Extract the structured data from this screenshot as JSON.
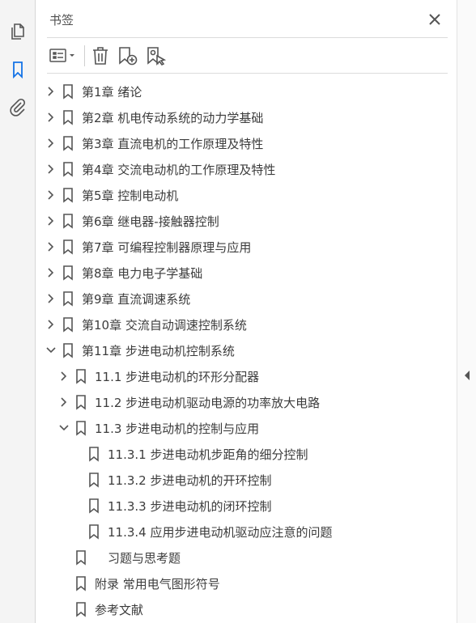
{
  "panel": {
    "title": "书签"
  },
  "rail": [
    {
      "icon": "pages-icon",
      "active": false
    },
    {
      "icon": "bookmark-icon",
      "active": true
    },
    {
      "icon": "paperclip-icon",
      "active": false
    }
  ],
  "toolbar": [
    "options-menu-icon",
    "delete-icon",
    "new-bookmark-icon",
    "bookmark-from-selection-icon"
  ],
  "colors": {
    "accent": "#1473e6",
    "icon": "#555555",
    "text": "#3c3c3c"
  },
  "bookmarks": [
    {
      "label": "第1章 绪论",
      "level": 0,
      "state": "collapsed"
    },
    {
      "label": "第2章 机电传动系统的动力学基础",
      "level": 0,
      "state": "collapsed"
    },
    {
      "label": "第3章 直流电机的工作原理及特性",
      "level": 0,
      "state": "collapsed"
    },
    {
      "label": "第4章 交流电动机的工作原理及特性",
      "level": 0,
      "state": "collapsed"
    },
    {
      "label": "第5章 控制电动机",
      "level": 0,
      "state": "collapsed"
    },
    {
      "label": "第6章 继电器-接触器控制",
      "level": 0,
      "state": "collapsed"
    },
    {
      "label": "第7章 可编程控制器原理与应用",
      "level": 0,
      "state": "collapsed"
    },
    {
      "label": "第8章 电力电子学基础",
      "level": 0,
      "state": "collapsed"
    },
    {
      "label": "第9章 直流调速系统",
      "level": 0,
      "state": "collapsed"
    },
    {
      "label": "第10章 交流自动调速控制系统",
      "level": 0,
      "state": "collapsed"
    },
    {
      "label": "第11章 步进电动机控制系统",
      "level": 0,
      "state": "expanded"
    },
    {
      "label": "11.1 步进电动机的环形分配器",
      "level": 1,
      "state": "collapsed"
    },
    {
      "label": "11.2 步进电动机驱动电源的功率放大电路",
      "level": 1,
      "state": "collapsed"
    },
    {
      "label": "11.3 步进电动机的控制与应用",
      "level": 1,
      "state": "expanded"
    },
    {
      "label": "11.3.1 步进电动机步距角的细分控制",
      "level": 2,
      "state": "leaf"
    },
    {
      "label": "11.3.2 步进电动机的开环控制",
      "level": 2,
      "state": "leaf"
    },
    {
      "label": "11.3.3 步进电动机的闭环控制",
      "level": 2,
      "state": "leaf"
    },
    {
      "label": "11.3.4 应用步进电动机驱动应注意的问题",
      "level": 2,
      "state": "leaf"
    },
    {
      "label": "习题与思考题",
      "level": 1,
      "state": "leaf",
      "extra_indent": true
    },
    {
      "label": "附录  常用电气图形符号",
      "level": 1,
      "state": "leaf"
    },
    {
      "label": "参考文献",
      "level": 1,
      "state": "leaf"
    }
  ]
}
